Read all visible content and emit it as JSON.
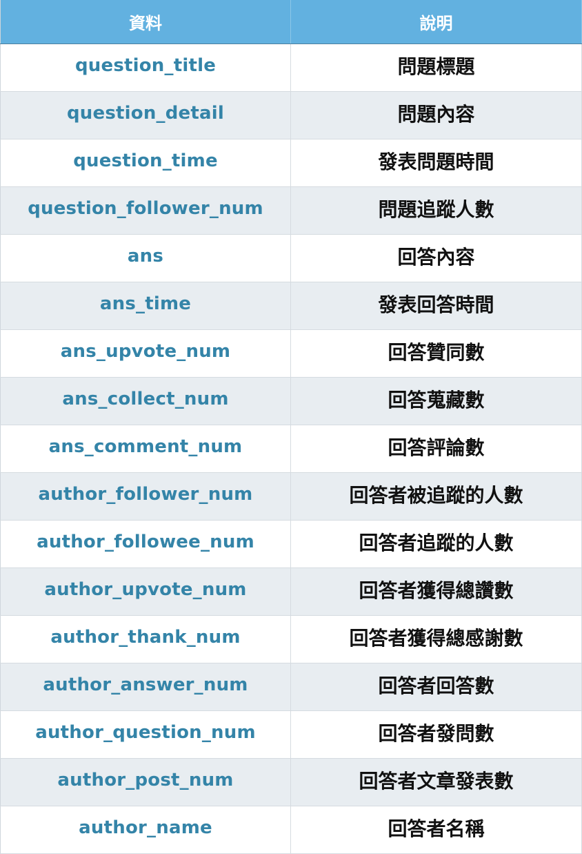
{
  "table": {
    "headers": [
      "資料",
      "說明"
    ],
    "rows": [
      {
        "field": "question_title",
        "desc": "問題標題"
      },
      {
        "field": "question_detail",
        "desc": "問題內容"
      },
      {
        "field": "question_time",
        "desc": "發表問題時間"
      },
      {
        "field": "question_follower_num",
        "desc": "問題追蹤人數"
      },
      {
        "field": "ans",
        "desc": "回答內容"
      },
      {
        "field": "ans_time",
        "desc": "發表回答時間"
      },
      {
        "field": "ans_upvote_num",
        "desc": "回答贊同數"
      },
      {
        "field": "ans_collect_num",
        "desc": "回答蒐藏數"
      },
      {
        "field": "ans_comment_num",
        "desc": "回答評論數"
      },
      {
        "field": "author_follower_num",
        "desc": "回答者被追蹤的人數"
      },
      {
        "field": "author_followee_num",
        "desc": "回答者追蹤的人數"
      },
      {
        "field": "author_upvote_num",
        "desc": "回答者獲得總讚數"
      },
      {
        "field": "author_thank_num",
        "desc": "回答者獲得總感謝數"
      },
      {
        "field": "author_answer_num",
        "desc": "回答者回答數"
      },
      {
        "field": "author_question_num",
        "desc": "回答者發問數"
      },
      {
        "field": "author_post_num",
        "desc": "回答者文章發表數"
      },
      {
        "field": "author_name",
        "desc": "回答者名稱"
      }
    ]
  },
  "colors": {
    "header_bg": "#62b1e0",
    "field_text": "#3484a8",
    "stripe_bg": "#e8edf1"
  }
}
